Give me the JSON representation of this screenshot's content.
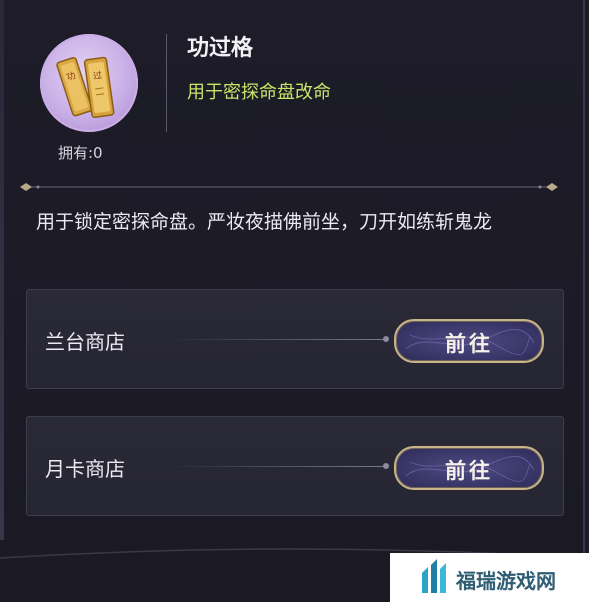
{
  "item": {
    "name": "功过格",
    "subtitle": "用于密探命盘改命",
    "owned_label": "拥有:0",
    "icon": "golden-tablets-icon",
    "description": "用于锁定密探命盘。严妆夜描佛前坐，刀开如练斩鬼龙"
  },
  "shops": [
    {
      "name": "兰台商店",
      "button_label": "前往"
    },
    {
      "name": "月卡商店",
      "button_label": "前往"
    }
  ],
  "watermark": {
    "text": "福瑞游戏网"
  },
  "colors": {
    "background": "#1b1a25",
    "subtitle": "#c9e46a",
    "button_border": "#c9b48a",
    "button_fill": "#3a376a",
    "icon_circle": "#c8aee6"
  }
}
